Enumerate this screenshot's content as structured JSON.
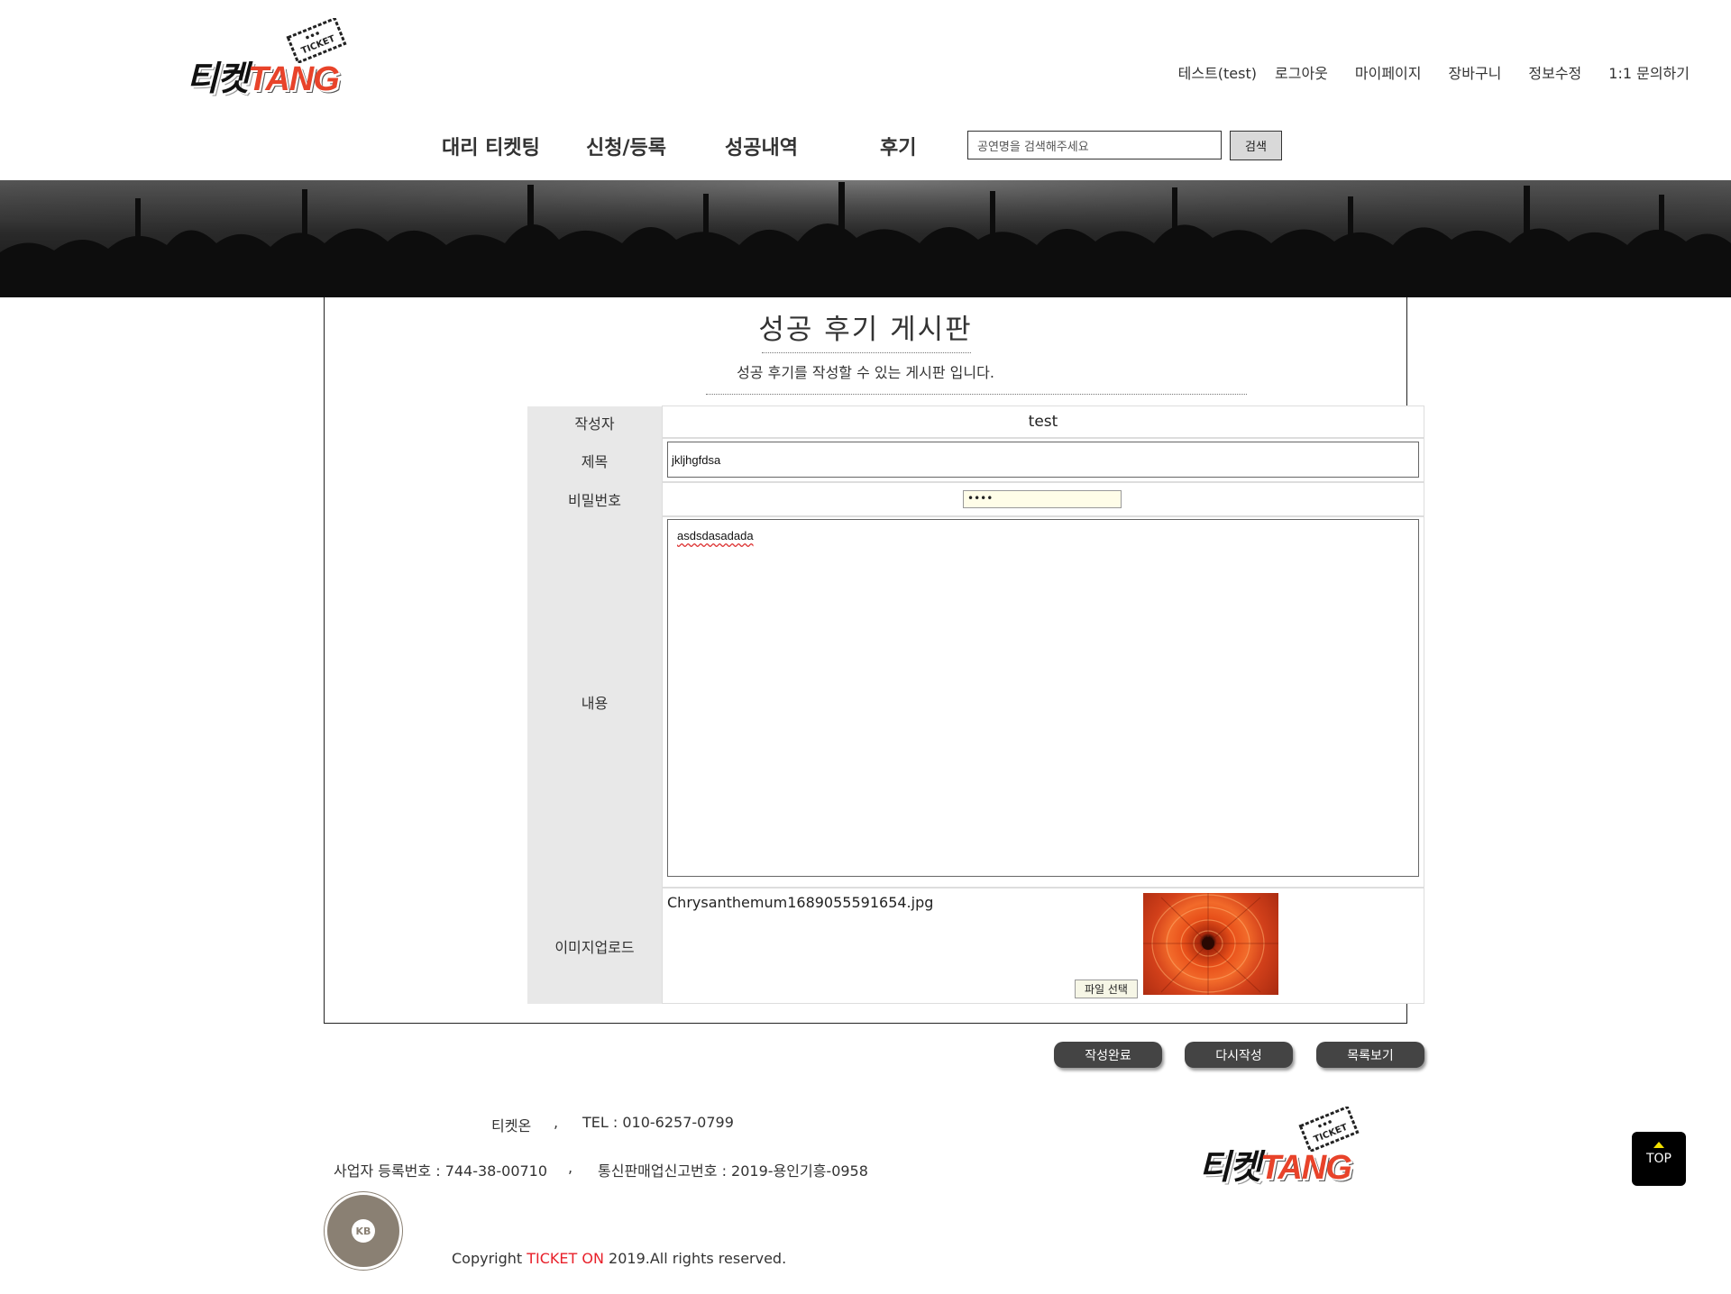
{
  "header": {
    "logo_text_dark": "티켓",
    "logo_text_accent": "TANG",
    "logo_ticket_label": "TICKET",
    "user_nav": [
      "테스트(test)",
      "로그아웃",
      "마이페이지",
      "장바구니",
      "정보수정",
      "1:1 문의하기"
    ]
  },
  "main_nav": [
    "대리 티켓팅",
    "신청/등록",
    "성공내역",
    "후기"
  ],
  "search": {
    "placeholder": "공연명을 검색해주세요",
    "button": "검색"
  },
  "board": {
    "title": "성공 후기 게시판",
    "subtitle": "성공 후기를 작성할 수 있는 게시판 입니다."
  },
  "form": {
    "author_label": "작성자",
    "author_value": "test",
    "title_label": "제목",
    "title_value": "jkljhgfdsa",
    "password_label": "비밀번호",
    "password_value": "••••",
    "content_label": "내용",
    "content_value": "asdsdasadada",
    "image_label": "이미지업로드",
    "image_filename": "Chrysanthemum1689055591654.jpg",
    "file_button": "파일 선택"
  },
  "actions": [
    "작성완료",
    "다시작성",
    "목록보기"
  ],
  "footer": {
    "company": "티켓온",
    "sep": ",",
    "tel": "TEL : 010-6257-0799",
    "biz_no": "사업자 등록번호 : 744-38-00710",
    "mail_order": "통신판매업신고번호 : 2019-용인기흥-0958",
    "copyright_pre": "Copyright ",
    "copyright_brand": "TICKET ON",
    "copyright_post": " 2019.All rights reserved.",
    "kb_badge_text": "KB",
    "top_button": "TOP"
  },
  "colors": {
    "accent": "#e8432a",
    "dark": "#444444",
    "label_bg": "#e8e8e8",
    "brand_red": "#e8202a"
  }
}
